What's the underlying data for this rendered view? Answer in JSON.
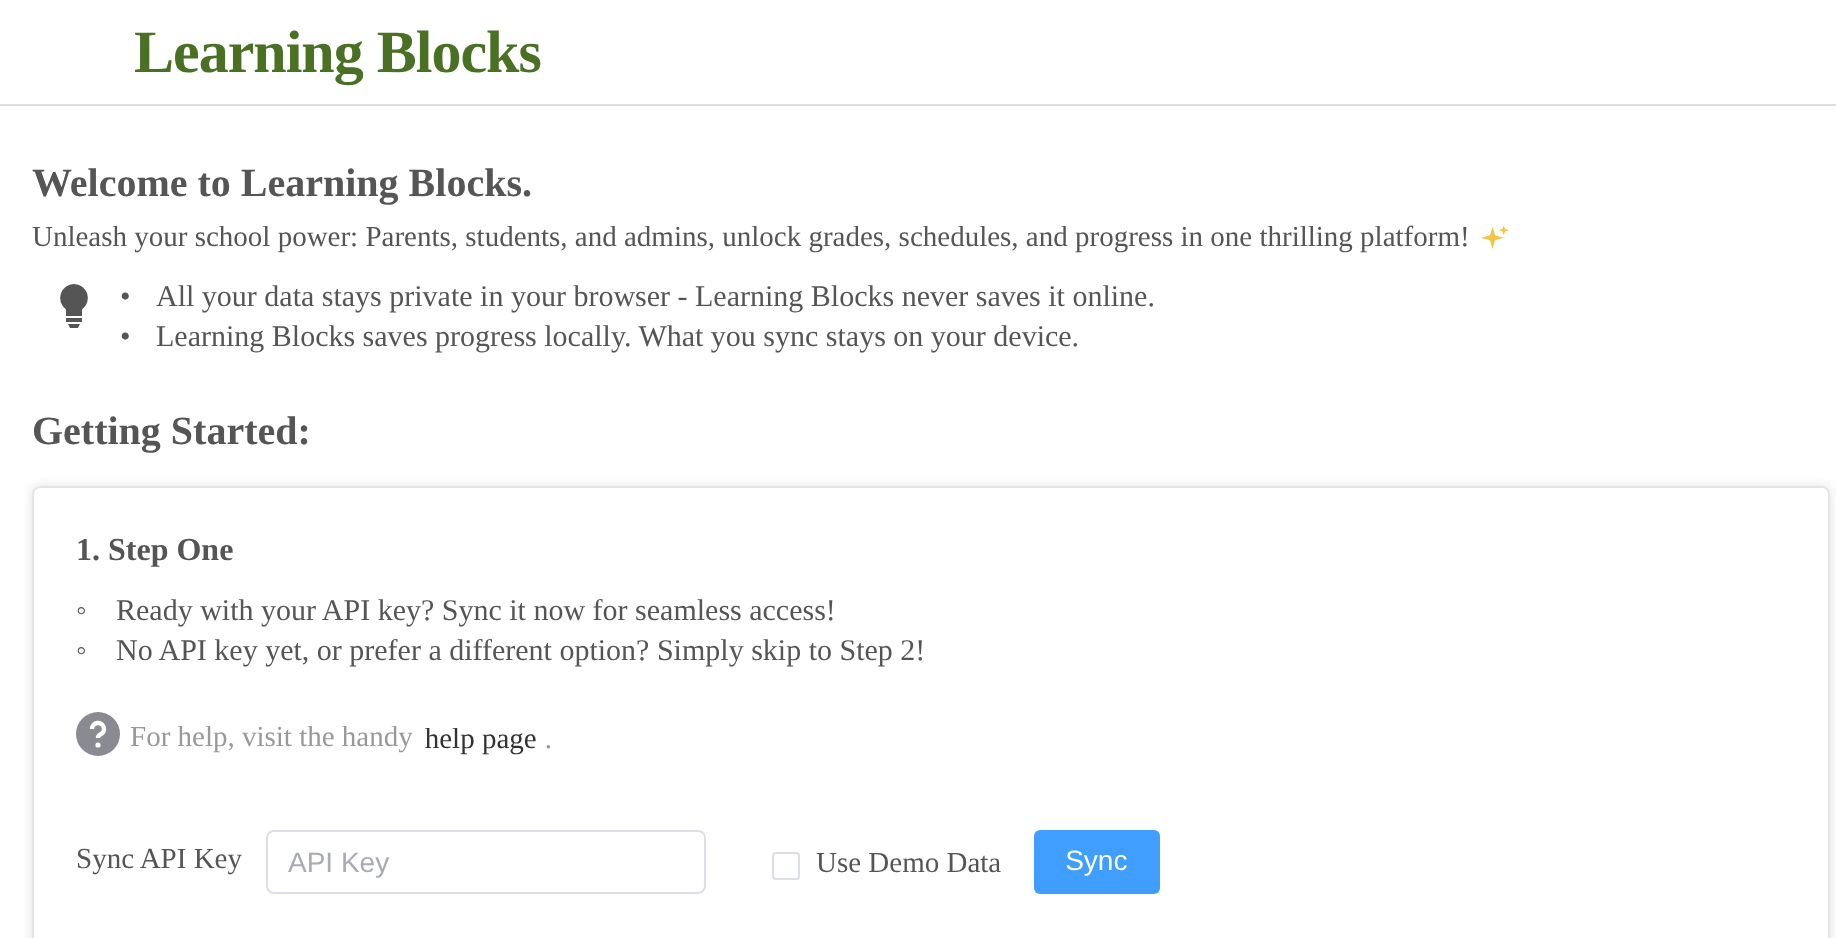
{
  "header": {
    "title": "Learning Blocks"
  },
  "welcome": {
    "heading": "Welcome to Learning Blocks.",
    "intro": "Unleash your school power: Parents, students, and admins, unlock grades, schedules, and progress in one thrilling platform!",
    "tips": [
      {
        "marker": "•",
        "text": "All your data stays private in your browser - Learning Blocks never saves it online."
      },
      {
        "marker": "•",
        "text": "Learning Blocks saves progress locally. What you sync stays on your device."
      }
    ]
  },
  "getting_started": {
    "heading": "Getting Started:",
    "step": {
      "title": "1. Step One",
      "items": [
        {
          "marker": "◦",
          "text": "Ready with your API key? Sync it now for seamless access!"
        },
        {
          "marker": "◦",
          "text": "No API key yet, or prefer a different option? Simply skip to Step 2!"
        }
      ],
      "help_text": "For help, visit the handy",
      "help_link": "help page",
      "help_end": ".",
      "sync_label": "Sync API Key",
      "api_key": {
        "placeholder": "API Key"
      },
      "demo": {
        "label": "Use Demo Data",
        "checked": false
      },
      "sync_button": "Sync"
    }
  }
}
